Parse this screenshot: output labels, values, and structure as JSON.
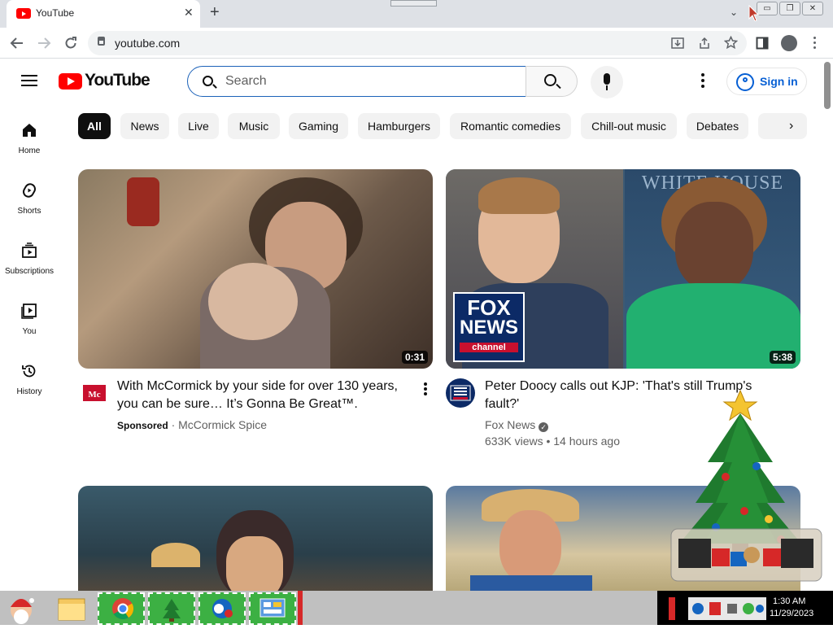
{
  "browser": {
    "tab_title": "YouTube",
    "tab_close": "✕",
    "new_tab": "+",
    "tab_search": "⌄",
    "url": "youtube.com",
    "window_controls": [
      "▭",
      "❐",
      "✕"
    ]
  },
  "masthead": {
    "logo_text": "YouTube",
    "search_placeholder": "Search",
    "signin_label": "Sign in"
  },
  "chips": [
    "All",
    "News",
    "Live",
    "Music",
    "Gaming",
    "Hamburgers",
    "Romantic comedies",
    "Chill-out music",
    "Debates"
  ],
  "chip_next": "›",
  "guide": [
    {
      "label": "Home",
      "icon": "home-icon"
    },
    {
      "label": "Shorts",
      "icon": "shorts-icon"
    },
    {
      "label": "Subscriptions",
      "icon": "subscriptions-icon"
    },
    {
      "label": "You",
      "icon": "you-library-icon"
    },
    {
      "label": "History",
      "icon": "history-icon"
    }
  ],
  "videos": [
    {
      "title_line1": "With McCormick by your side for over 130 years,",
      "title_line2": "you can be sure… It’s Gonna Be Great™.",
      "duration": "0:31",
      "sponsored": "Sponsored",
      "separator": "·",
      "channel": "McCormick Spice",
      "avatar_label": "Mc"
    },
    {
      "title_line1": "Peter Doocy calls out KJP: 'That's still Trump's",
      "title_line2": "fault?'",
      "duration": "5:38",
      "channel": "Fox News",
      "stats": "633K views • 14 hours ago",
      "logo_line1": "FOX",
      "logo_line2": "NEWS",
      "logo_line3": "channel",
      "backdrop_text": "WHITE HOUSE"
    }
  ],
  "taskbar": {
    "time": "1:30 AM",
    "date": "11/29/2023"
  },
  "colors": {
    "youtube_red": "#ff0000",
    "link_blue": "#065fd4",
    "chip_bg": "#f2f2f2",
    "chip_active": "#0f0f0f"
  }
}
